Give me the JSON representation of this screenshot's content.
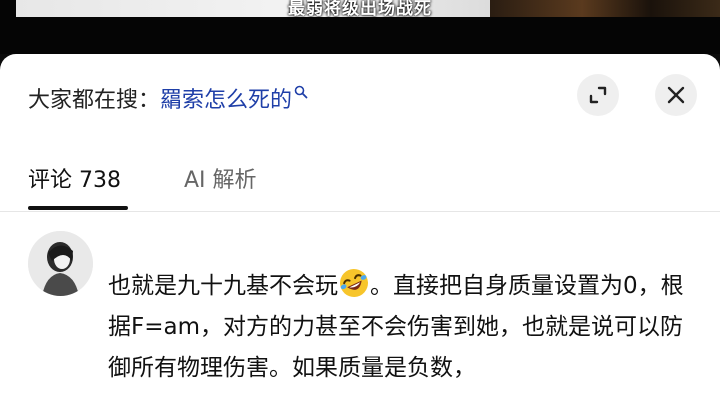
{
  "video": {
    "subtitle": "最弱将级出场战死"
  },
  "header": {
    "search_prefix": "大家都在搜：",
    "search_query": "羂索怎么死的",
    "expand_icon": "expand-icon",
    "close_icon": "close-icon"
  },
  "tabs": [
    {
      "label": "评论 738",
      "active": true
    },
    {
      "label": "AI 解析",
      "active": false
    }
  ],
  "comment": {
    "avatar_icon": "avatar",
    "text_before_emoji": "也就是九十九基不会玩",
    "emoji_name": "rolling-on-floor-laughing-emoji",
    "text_after_emoji": "。直接把自身质量设置为0，根据F=am，对方的力甚至不会伤害到她，也就是说可以防御所有物理伤害。如果质量是负数，"
  },
  "colors": {
    "query_link": "#1f3fa8",
    "sheet_bg": "#ffffff",
    "button_bg": "#efefef"
  }
}
